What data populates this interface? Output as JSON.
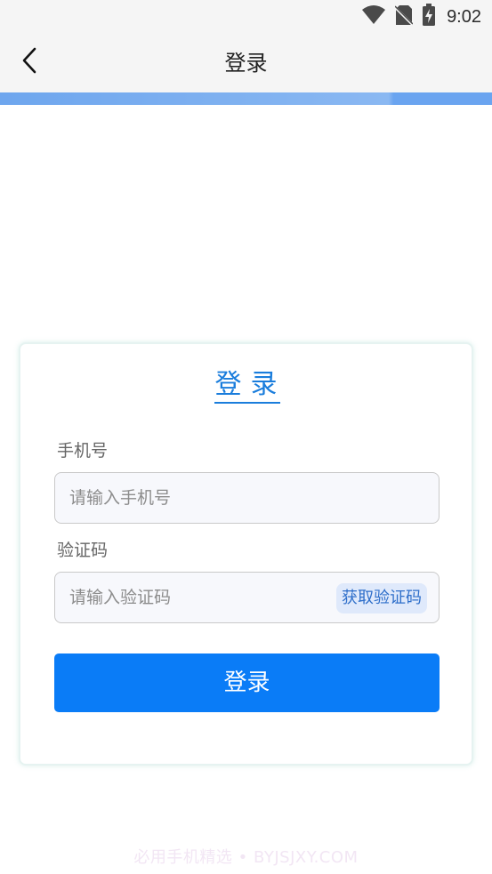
{
  "status_bar": {
    "time": "9:02",
    "icons": [
      "wifi-icon",
      "no-sim-icon",
      "battery-charging-icon"
    ]
  },
  "app_bar": {
    "title": "登录",
    "back_icon": "chevron-left-icon"
  },
  "card": {
    "title": "登录",
    "phone": {
      "label": "手机号",
      "placeholder": "请输入手机号",
      "value": ""
    },
    "code": {
      "label": "验证码",
      "placeholder": "请输入验证码",
      "value": "",
      "get_code_label": "获取验证码"
    },
    "submit_label": "登录"
  },
  "watermark": "必用手机精选 • BYJSJXY.COM",
  "colors": {
    "accent": "#0a7cf7",
    "title_blue": "#1a7ddc",
    "app_bar_bg": "#f5f5f5",
    "app_bar_accent": "#6ea6ee",
    "get_code_bg": "#dfe9fb"
  }
}
